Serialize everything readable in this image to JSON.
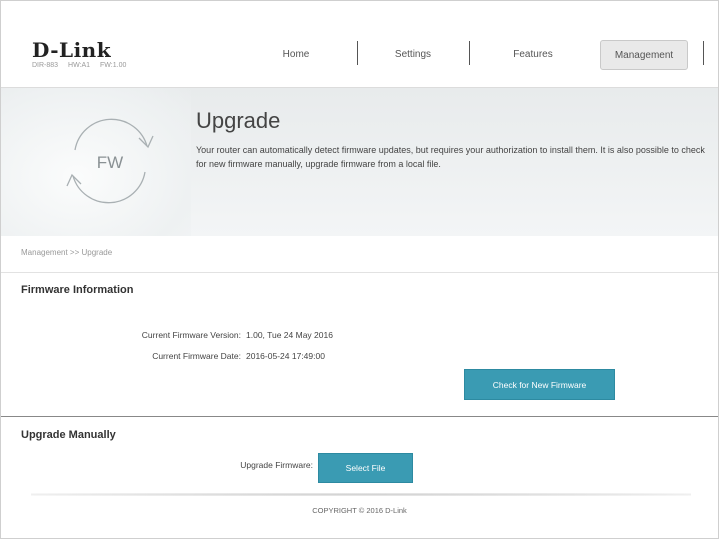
{
  "header": {
    "brand": "D-Link",
    "model": "DIR-883",
    "hw": "HW:A1",
    "fw": "FW:1.00",
    "nav": [
      {
        "label": "Home"
      },
      {
        "label": "Settings"
      },
      {
        "label": "Features"
      },
      {
        "label": "Management",
        "active": true
      }
    ]
  },
  "banner": {
    "icon_text": "FW",
    "title": "Upgrade",
    "description": "Your router can automatically detect firmware updates, but requires your authorization to install them. It is also possible to check for new firmware manually, upgrade firmware from a local file."
  },
  "breadcrumb": "Management >> Upgrade",
  "firmware_info": {
    "title": "Firmware Information",
    "version_label": "Current Firmware Version:",
    "version_value": "1.00, Tue 24 May 2016",
    "date_label": "Current Firmware Date:",
    "date_value": "2016-05-24 17:49:00",
    "check_button": "Check for New Firmware"
  },
  "upgrade_manually": {
    "title": "Upgrade Manually",
    "label": "Upgrade Firmware:",
    "select_button": "Select File"
  },
  "footer": {
    "copyright": "COPYRIGHT © 2016 D-Link"
  },
  "colors": {
    "accent": "#3a9bb3",
    "banner_bg": "#eceff0"
  }
}
